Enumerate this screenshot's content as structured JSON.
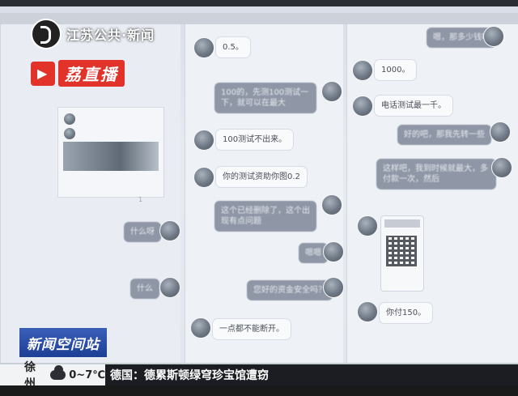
{
  "broadcast": {
    "channel_logo_text": "江苏公共·新闻",
    "app_logo_text": "荔直播",
    "program_title": "新闻空间站",
    "weather_city": "徐州",
    "weather_temp": "0~7℃",
    "ticker_text": "德国：德累斯顿绿穹珍宝馆遭窃"
  },
  "chat": {
    "left_panel": {
      "messages": [
        {
          "side": "out",
          "text": "什么呀"
        },
        {
          "side": "out",
          "text": "什么"
        },
        {
          "side": "in",
          "text": "一点都不能断开。"
        }
      ],
      "post_counts": "1"
    },
    "middle_panel": {
      "messages": [
        {
          "side": "in",
          "text": "0.5。"
        },
        {
          "side": "out",
          "text": "100的，先测100测试一下，就可以在最大"
        },
        {
          "side": "in",
          "text": "100测试不出来。"
        },
        {
          "side": "in",
          "text": "你的测试资助你图0.2"
        },
        {
          "side": "out",
          "text": "这个已经删除了，这个出现有点问题"
        },
        {
          "side": "out",
          "text": "嗯嗯"
        },
        {
          "side": "out",
          "text": "您好的资金安全吗？"
        }
      ]
    },
    "right_panel": {
      "messages": [
        {
          "side": "out",
          "text": "嗯，那多少钱呢"
        },
        {
          "side": "in",
          "text": "1000。"
        },
        {
          "side": "in",
          "text": "电话测试最一千。"
        },
        {
          "side": "out",
          "text": "好的吧，那我先转一些"
        },
        {
          "side": "out",
          "text": "这样吧，我到时候就最大，多付款一次，然后"
        },
        {
          "side": "in",
          "text": "你付150。"
        }
      ]
    }
  },
  "icons": {
    "cloud": "cloud-icon",
    "channel": "channel-logo-icon",
    "app": "play-icon"
  }
}
